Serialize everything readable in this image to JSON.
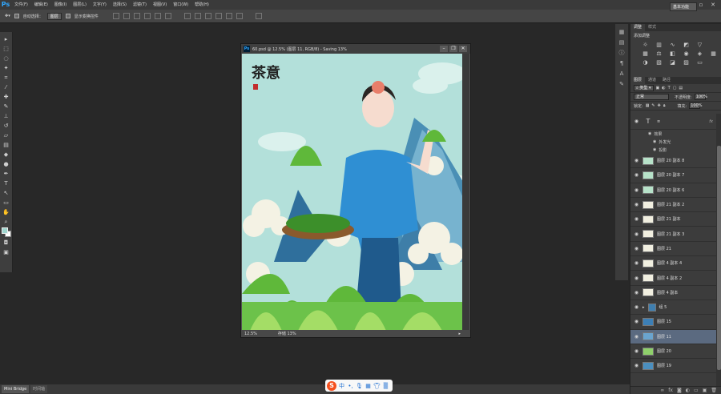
{
  "menu": {
    "logo": "Ps",
    "items": [
      "文件(F)",
      "编辑(E)",
      "图像(I)",
      "图层(L)",
      "文字(Y)",
      "选择(S)",
      "滤镜(T)",
      "视图(V)",
      "窗口(W)",
      "帮助(H)"
    ]
  },
  "options": {
    "auto_select_label": "自动选择：",
    "auto_select_value": "图层",
    "show_transform_label": "显示变换控件",
    "workspace": "基本功能"
  },
  "document": {
    "title": "60.psd @ 12.5% (图层 11, RGB/8) - Saving 13%",
    "zoom": "12.5%",
    "status": "存储 13%",
    "artwork_calligraphy": "茶意"
  },
  "panels": {
    "top_tabs": [
      "调整",
      "样式"
    ],
    "adjust_title": "添加调整",
    "layer_tabs": [
      "图层",
      "通道",
      "路径"
    ],
    "kind_filter": "类型",
    "blend_mode": "正常",
    "opacity_label": "不透明度:",
    "opacity_value": "100%",
    "lock_label": "锁定:",
    "fill_label": "填充:",
    "fill_value": "100%",
    "effects_label": "效果",
    "effects": [
      "外发光",
      "投影"
    ],
    "fx_badge": "fx",
    "layers": [
      {
        "name": "图层 20 副本 8"
      },
      {
        "name": "图层 20 副本 7"
      },
      {
        "name": "图层 20 副本 6"
      },
      {
        "name": "图层 21 副本 2"
      },
      {
        "name": "图层 21 副本"
      },
      {
        "name": "图层 21 副本 3"
      },
      {
        "name": "图层 21"
      },
      {
        "name": "图层 4 副本 4"
      },
      {
        "name": "图层 4 副本 2"
      },
      {
        "name": "图层 4 副本"
      },
      {
        "name": "组 5"
      },
      {
        "name": "图层 15"
      },
      {
        "name": "图层 11"
      },
      {
        "name": "图层 20"
      },
      {
        "name": "图层 19"
      }
    ]
  },
  "bottom": {
    "tabs": [
      "Mini Bridge",
      "时间轴"
    ],
    "ime_label": "中"
  }
}
